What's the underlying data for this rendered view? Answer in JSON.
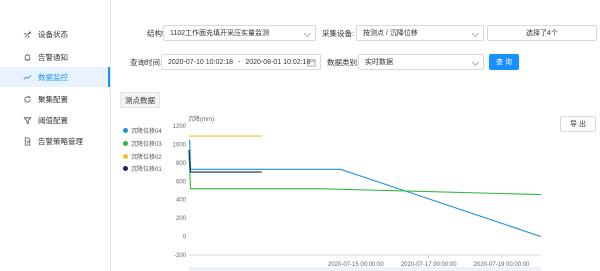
{
  "sidebar": {
    "items": [
      {
        "label": "设备状态",
        "icon": "rocket-icon"
      },
      {
        "label": "告警通知",
        "icon": "bell-icon"
      },
      {
        "label": "数据监控",
        "icon": "chart-icon",
        "active": true
      },
      {
        "label": "聚集配置",
        "icon": "refresh-icon"
      },
      {
        "label": "阈值配置",
        "icon": "filter-icon"
      },
      {
        "label": "告警策略管理",
        "icon": "document-icon"
      }
    ]
  },
  "filters": {
    "structure_label": "结构物:",
    "structure_value": "1102工作面充填开采压实量监测",
    "device_label": "采集设备:",
    "device_value": "按测点 / 沉降位移",
    "selected_count": "选择了4个",
    "time_label": "查询时间:",
    "time_start": "2020-07-10 10:02:18",
    "time_sep": "-",
    "time_end": "2020-08-01 10:02:18",
    "data_type_label": "数据类别:",
    "data_type_value": "实时数据",
    "query_button": "查 询"
  },
  "tab_label": "测点数据",
  "export_button": "导 出",
  "colors": {
    "accent": "#1890ff",
    "active_bg": "#e8f3ff",
    "series_04": "#1f8fe0",
    "series_03": "#2db83d",
    "series_02": "#f2c12e",
    "series_01": "#1a2b5c"
  },
  "chart_data": {
    "type": "line",
    "ylabel": "沉降(mm)",
    "ylim": [
      -200,
      1200
    ],
    "yticks": [
      "1200",
      "1000",
      "800",
      "600",
      "400",
      "200",
      "0",
      "-200"
    ],
    "xticks": [
      "2020-07-15 00:00:00",
      "2020-07-17 00:00:00",
      "2020-07-19 00:00:00"
    ],
    "xlim": [
      "2020-07-10 10:02:18",
      "2020-07-20 02:00:00"
    ],
    "legend_position": "left",
    "grid": false,
    "series": [
      {
        "name": "沉降位移04",
        "color": "#1f8fe0",
        "points": [
          [
            "2020-07-10 10:02:18",
            1045
          ],
          [
            "2020-07-10 10:30:00",
            1045
          ],
          [
            "2020-07-10 11:00:00",
            730
          ],
          [
            "2020-07-11 11:00:00",
            730
          ],
          [
            "2020-07-14 14:00:00",
            730
          ],
          [
            "2020-07-20 02:00:00",
            0
          ]
        ]
      },
      {
        "name": "沉降位移03",
        "color": "#2db83d",
        "points": [
          [
            "2020-07-10 10:02:18",
            900
          ],
          [
            "2020-07-10 11:00:00",
            520
          ],
          [
            "2020-07-14 00:00:00",
            520
          ],
          [
            "2020-07-20 02:00:00",
            455
          ]
        ]
      },
      {
        "name": "沉降位移02",
        "color": "#f2c12e",
        "points": [
          [
            "2020-07-10 10:02:18",
            1090
          ],
          [
            "2020-07-10 12:00:00",
            1090
          ],
          [
            "2020-07-11 10:00:00",
            1090
          ],
          [
            "2020-07-12 10:00:00",
            1090
          ]
        ]
      },
      {
        "name": "沉降位移01",
        "color": "#1a2b5c",
        "points": [
          [
            "2020-07-10 10:02:18",
            940
          ],
          [
            "2020-07-10 11:00:00",
            700
          ],
          [
            "2020-07-12 10:00:00",
            700
          ]
        ]
      }
    ]
  }
}
